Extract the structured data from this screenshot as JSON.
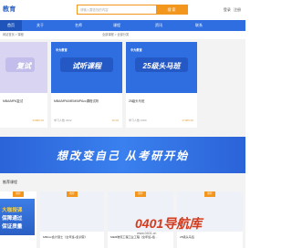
{
  "header": {
    "logo": "教育",
    "search_placeholder": "请输入要查找的内容",
    "search_button": "搜 索",
    "login": "登录",
    "register": "注册"
  },
  "nav": [
    {
      "label": "首页",
      "active": true
    },
    {
      "label": "关于"
    },
    {
      "label": "名师"
    },
    {
      "label": "课程"
    },
    {
      "label": "资讯"
    },
    {
      "label": "联系"
    }
  ],
  "crumb": {
    "left": "网站首页 > 课程",
    "right": "全部课程 > 全部分类"
  },
  "cards": [
    {
      "brand": "",
      "slogan": "复试",
      "title": "MBA/MPA复试",
      "meta": "",
      "price": "¥3980.00",
      "color": "#c9c5ec"
    },
    {
      "brand": "中大教育",
      "slogan": "试听课程",
      "title": "MBA/MPA/MEM/MPAcc课程试听",
      "meta": "学习人数 2342",
      "price": "¥0.00",
      "color": "#2f6ee0"
    },
    {
      "brand": "中大教育",
      "slogan": "25级头马班",
      "title": "25级头马班",
      "meta": "学习人数 1580",
      "price": "¥7980.00",
      "color": "#2f6ee0"
    }
  ],
  "strip": {
    "text": "想改变自己 从考研开始"
  },
  "section_title": "推荐课程",
  "bottom_cards": [
    {
      "tag": "推荐",
      "title": ""
    },
    {
      "tag": "推荐",
      "title": "MBAcc会计硕士（全年班+集训营）"
    },
    {
      "tag": "推荐",
      "title": "MEM物流工程工业工程（全年班+集..."
    },
    {
      "tag": "推荐",
      "title": "25级头马班"
    }
  ],
  "ad": {
    "l1": "大咖授课",
    "l2": "保障通过",
    "l3": "保证质量"
  },
  "watermark": {
    "main": "0401导航库",
    "sub": "www.0401.cn"
  }
}
